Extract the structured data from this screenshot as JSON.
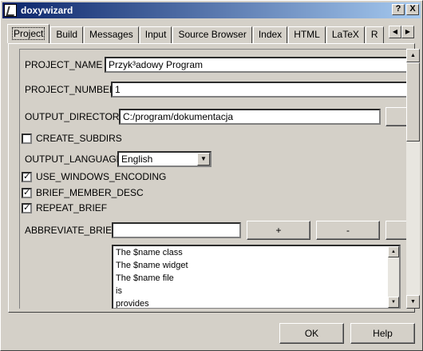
{
  "window": {
    "title": "doxywizard",
    "help_btn": "?",
    "close_btn": "X"
  },
  "tabs": [
    "Project",
    "Build",
    "Messages",
    "Input",
    "Source Browser",
    "Index",
    "HTML",
    "LaTeX",
    "R"
  ],
  "tab_scroll": {
    "left": "◀",
    "right": "▶"
  },
  "form": {
    "project_name_label": "PROJECT_NAME",
    "project_name_value": "Przyk³adowy Program",
    "project_number_label": "PROJECT_NUMBER",
    "project_number_value": "1",
    "output_directory_label": "OUTPUT_DIRECTORY",
    "output_directory_value": "C:/program/dokumentacja",
    "create_subdirs_label": "CREATE_SUBDIRS",
    "create_subdirs_checked": "",
    "output_language_label": "OUTPUT_LANGUAGE",
    "output_language_value": "English",
    "use_windows_encoding_label": "USE_WINDOWS_ENCODING",
    "use_windows_encoding_checked": "✓",
    "brief_member_desc_label": "BRIEF_MEMBER_DESC",
    "brief_member_desc_checked": "✓",
    "repeat_brief_label": "REPEAT_BRIEF",
    "repeat_brief_checked": "✓",
    "abbreviate_brief_label": "ABBREVIATE_BRIEF",
    "abbreviate_brief_value": "",
    "add_label": "+",
    "remove_label": "-",
    "abbreviate_brief_items": [
      "The $name class",
      "The $name widget",
      "The $name file",
      "is",
      "provides"
    ]
  },
  "footer": {
    "ok_label": "OK",
    "help_label": "Help"
  },
  "scroll_arrows": {
    "up": "▲",
    "down": "▼"
  }
}
